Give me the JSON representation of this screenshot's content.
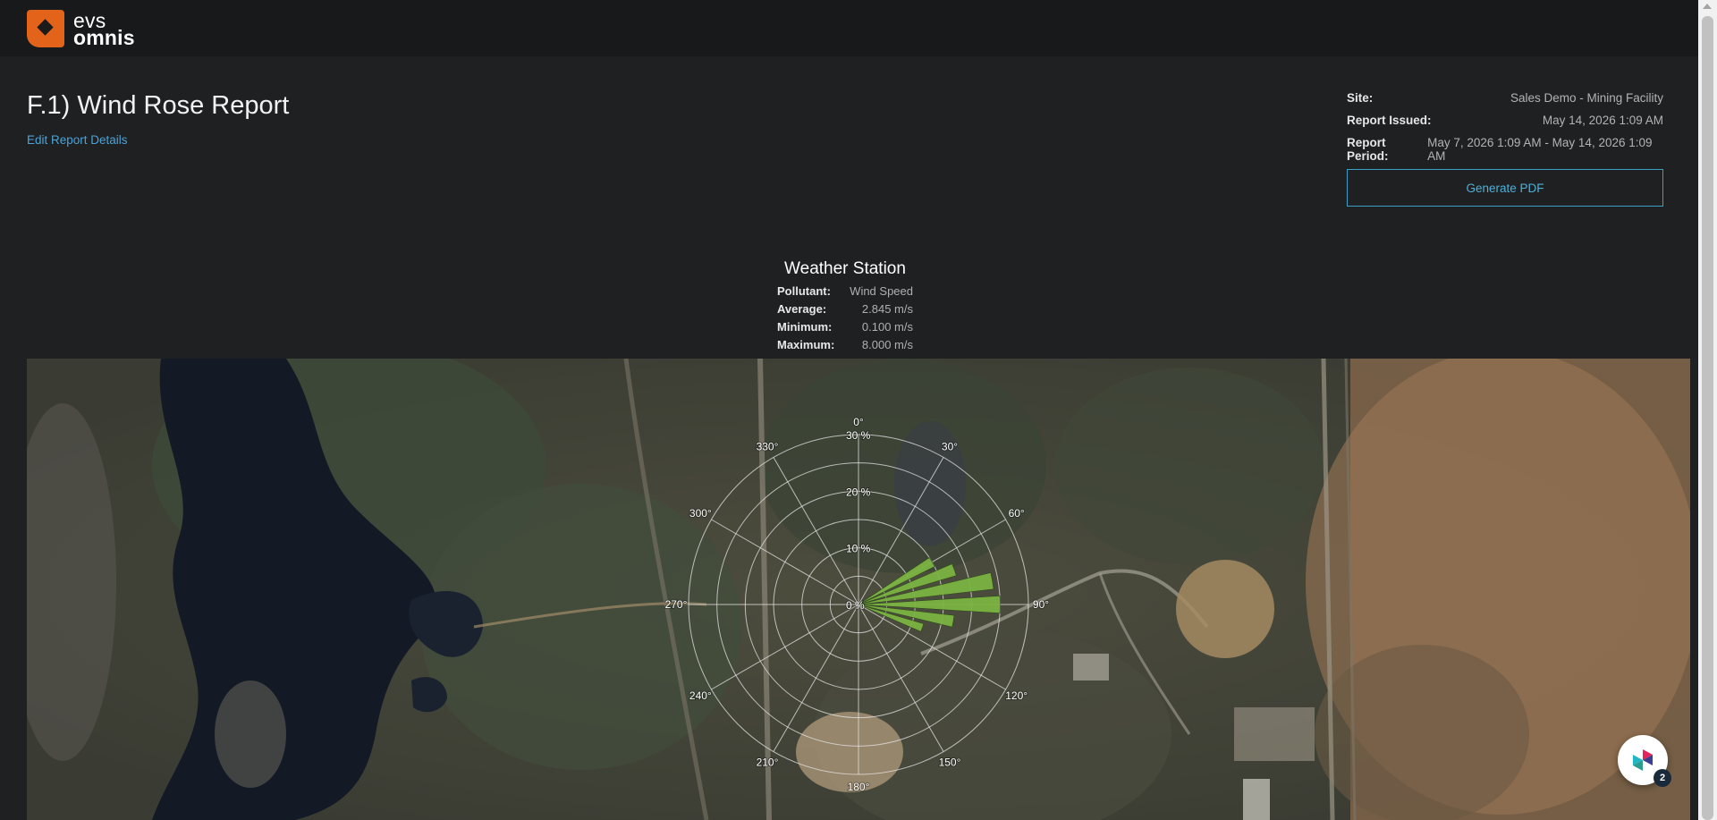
{
  "app": {
    "brand_line1": "evs",
    "brand_line2": "omnis"
  },
  "report": {
    "title": "F.1) Wind Rose Report",
    "edit_link": "Edit Report Details",
    "meta": [
      {
        "label": "Site:",
        "value": "Sales Demo - Mining Facility"
      },
      {
        "label": "Report Issued:",
        "value": "May 14, 2026 1:09 AM"
      },
      {
        "label": "Report Period:",
        "value": "May 7, 2026 1:09 AM - May 14, 2026 1:09 AM"
      }
    ],
    "pdf_button": "Generate PDF"
  },
  "station": {
    "title": "Weather Station",
    "stats": [
      {
        "label": "Pollutant:",
        "value": "Wind Speed"
      },
      {
        "label": "Average:",
        "value": "2.845 m/s"
      },
      {
        "label": "Minimum:",
        "value": "0.100 m/s"
      },
      {
        "label": "Maximum:",
        "value": "8.000 m/s"
      }
    ]
  },
  "chart_data": {
    "type": "wind-rose",
    "radial_unit": "%",
    "radial_ticks": [
      0,
      10,
      20,
      30
    ],
    "radial_tick_labels": [
      "0 %",
      "10 %",
      "20 %",
      "30 %"
    ],
    "radial_max": 30,
    "angle_ticks": [
      0,
      30,
      60,
      90,
      120,
      150,
      180,
      210,
      240,
      270,
      300,
      330
    ],
    "angle_tick_labels": [
      "0°",
      "30°",
      "60°",
      "90°",
      "120°",
      "150°",
      "180°",
      "210°",
      "240°",
      "270°",
      "300°",
      "330°"
    ],
    "sector_width_deg": 7,
    "sectors": [
      {
        "direction": 60,
        "value": 15
      },
      {
        "direction": 70,
        "value": 18
      },
      {
        "direction": 80,
        "value": 24
      },
      {
        "direction": 90,
        "value": 25
      },
      {
        "direction": 100,
        "value": 17
      },
      {
        "direction": 110,
        "value": 12
      }
    ],
    "bar_color": "#7bb342",
    "grid_color": "#e6e6e6"
  },
  "chat": {
    "badge_count": "2"
  }
}
